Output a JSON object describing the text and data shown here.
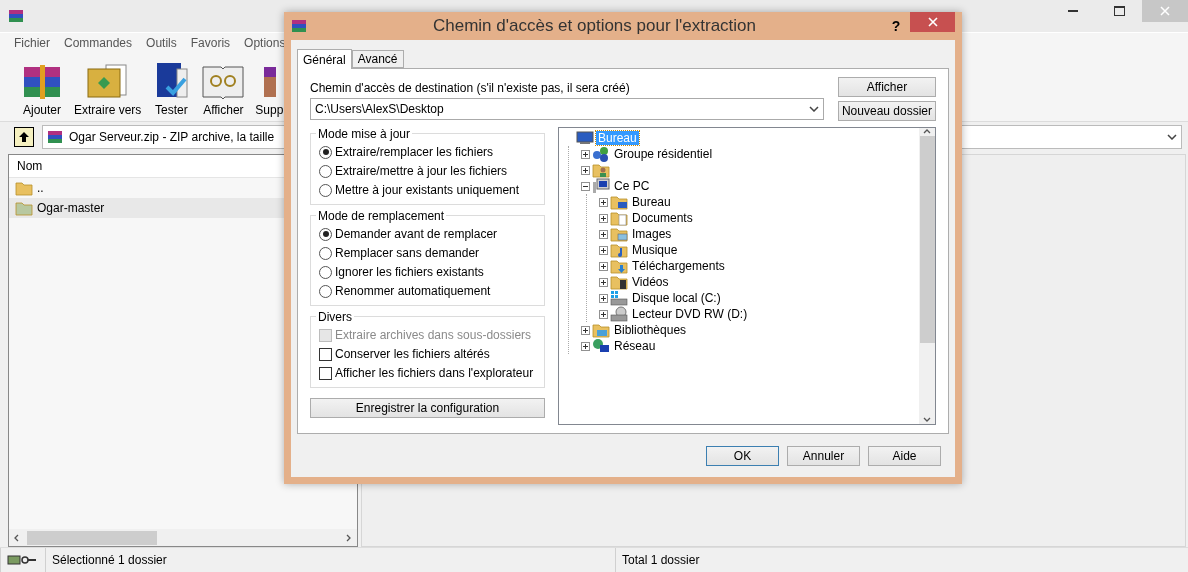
{
  "main_window": {
    "menu": [
      "Fichier",
      "Commandes",
      "Outils",
      "Favoris",
      "Options"
    ],
    "toolbar": [
      {
        "label": "Ajouter",
        "kind": "add"
      },
      {
        "label": "Extraire vers",
        "kind": "extract"
      },
      {
        "label": "Tester",
        "kind": "test"
      },
      {
        "label": "Afficher",
        "kind": "view"
      },
      {
        "label": "Supp",
        "kind": "delete"
      }
    ],
    "address": "Ogar Serveur.zip - ZIP archive, la taille",
    "file_list": {
      "columns": [
        "Nom"
      ],
      "rows": [
        {
          "name": "..",
          "selected": false
        },
        {
          "name": "Ogar-master",
          "selected": true
        }
      ]
    },
    "status_bar": [
      "Sélectionné 1 dossier",
      "Total 1 dossier"
    ]
  },
  "dialog": {
    "title": "Chemin d'accès et options pour l'extraction",
    "help": "?",
    "tabs": [
      {
        "label": "Général",
        "selected": true
      },
      {
        "label": "Avancé",
        "selected": false
      }
    ],
    "destination_label": "Chemin d'accès de destination (s'il n'existe pas, il sera créé)",
    "destination_value": "C:\\Users\\AlexS\\Desktop",
    "side_buttons": [
      "Afficher",
      "Nouveau dossier"
    ],
    "groups": [
      {
        "title": "Mode mise à jour",
        "kind": "radio",
        "options": [
          {
            "label": "Extraire/remplacer les fichiers",
            "selected": true
          },
          {
            "label": "Extraire/mettre à jour les fichiers",
            "selected": false
          },
          {
            "label": "Mettre à jour existants uniquement",
            "selected": false
          }
        ]
      },
      {
        "title": "Mode de remplacement",
        "kind": "radio",
        "options": [
          {
            "label": "Demander avant de remplacer",
            "selected": true
          },
          {
            "label": "Remplacer sans demander",
            "selected": false
          },
          {
            "label": "Ignorer les fichiers existants",
            "selected": false
          },
          {
            "label": "Renommer automatiquement",
            "selected": false
          }
        ]
      },
      {
        "title": "Divers",
        "kind": "checkbox",
        "options": [
          {
            "label": "Extraire archives dans sous-dossiers",
            "checked": false,
            "disabled": true
          },
          {
            "label": "Conserver les fichiers altérés",
            "checked": false,
            "disabled": false
          },
          {
            "label": "Afficher les fichiers dans l'explorateur",
            "checked": false,
            "disabled": false
          }
        ]
      }
    ],
    "save_button": "Enregistrer la configuration",
    "tree": [
      {
        "label": "Bureau",
        "kind": "desktop",
        "selected": true,
        "children": [
          {
            "label": "Groupe résidentiel",
            "kind": "homegroup",
            "expanded": false,
            "selected": false
          },
          {
            "kind": "user",
            "expanded": false,
            "selected": false
          },
          {
            "label": "Ce PC",
            "kind": "pc",
            "expanded": true,
            "selected": false,
            "children": [
              {
                "label": "Bureau",
                "kind": "folder-desktop",
                "expanded": false,
                "selected": false
              },
              {
                "label": "Documents",
                "kind": "folder-docs",
                "expanded": false,
                "selected": false
              },
              {
                "label": "Images",
                "kind": "folder-images",
                "expanded": false,
                "selected": false
              },
              {
                "label": "Musique",
                "kind": "folder-music",
                "expanded": false,
                "selected": false
              },
              {
                "label": "Téléchargements",
                "kind": "folder-downloads",
                "expanded": false,
                "selected": false
              },
              {
                "label": "Vidéos",
                "kind": "folder-videos",
                "expanded": false,
                "selected": false
              },
              {
                "label": "Disque local (C:)",
                "kind": "drive",
                "expanded": false,
                "selected": false
              },
              {
                "label": "Lecteur DVD RW (D:)",
                "kind": "dvd",
                "expanded": false,
                "selected": false
              }
            ]
          },
          {
            "label": "Bibliothèques",
            "kind": "libraries",
            "expanded": false,
            "selected": false
          },
          {
            "label": "Réseau",
            "kind": "network",
            "expanded": false,
            "selected": false
          }
        ]
      }
    ],
    "buttons": [
      {
        "label": "OK",
        "default": true
      },
      {
        "label": "Annuler",
        "default": false
      },
      {
        "label": "Aide",
        "default": false
      }
    ]
  }
}
